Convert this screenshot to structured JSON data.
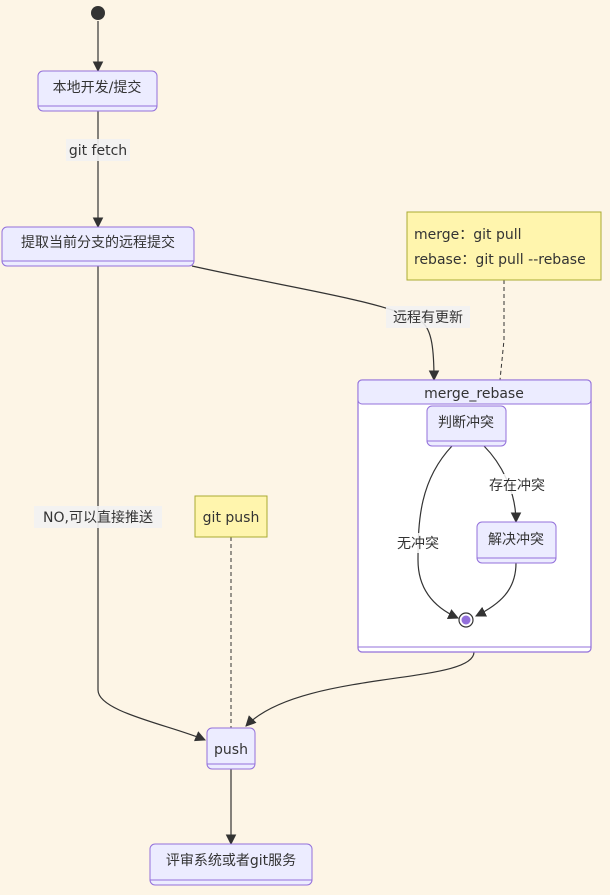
{
  "states": {
    "local_dev": "本地开发/提交",
    "fetch_remote": "提取当前分支的远程提交",
    "merge_rebase": "merge_rebase",
    "judge_conflict": "判断冲突",
    "resolve_conflict": "解决冲突",
    "push": "push",
    "review": "评审系统或者git服务"
  },
  "transitions": {
    "git_fetch": "git fetch",
    "remote_updated": "远程有更新",
    "no_push_direct": "NO,可以直接推送",
    "has_conflict": "存在冲突",
    "no_conflict": "无冲突"
  },
  "notes": {
    "merge_line": "merge：git pull",
    "rebase_line": "rebase：git pull --rebase",
    "git_push": "git push"
  },
  "colors": {
    "background": "#fdf5e6",
    "state_fill": "#ececff",
    "state_border": "#9370db",
    "note_fill": "#fff5ad",
    "note_border": "#aaaa33",
    "edge": "#333333"
  }
}
